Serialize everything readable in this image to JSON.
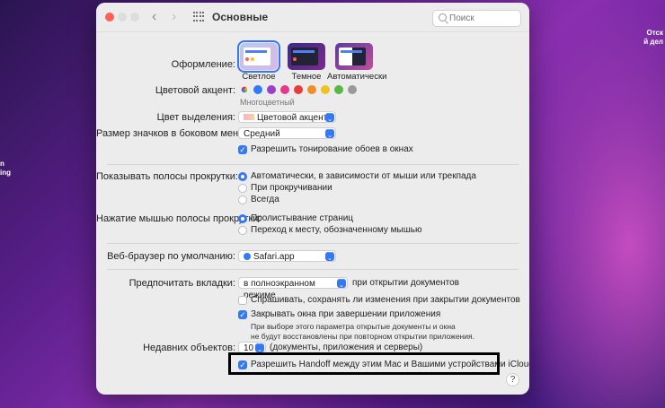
{
  "desktop": {
    "left_text_1": "n",
    "left_text_2": "ing",
    "right_text_1": "Отск",
    "right_text_2": "й дел"
  },
  "window": {
    "title": "Основные",
    "search_placeholder": "Поиск"
  },
  "appearance": {
    "label": "Оформление:",
    "options": [
      {
        "label": "Светлое",
        "selected": true
      },
      {
        "label": "Темное",
        "selected": false
      },
      {
        "label": "Автоматически",
        "selected": false
      }
    ]
  },
  "accent": {
    "label": "Цветовой акцент:",
    "caption": "Многоцветный",
    "colors": [
      "multicolor",
      "#2f7cf6",
      "#9a41c9",
      "#e6388b",
      "#ea3a3a",
      "#f18d26",
      "#f2c11c",
      "#5ab743",
      "#9a9a9a"
    ]
  },
  "highlight": {
    "label": "Цвет выделения:",
    "value": "Цветовой акцент"
  },
  "sidebar_icon": {
    "label": "Размер значков в боковом меню:",
    "value": "Средний"
  },
  "wallpaper_tint": {
    "label": "Разрешить тонирование обоев в окнах",
    "checked": true
  },
  "scrollbars": {
    "label": "Показывать полосы прокрутки:",
    "options": [
      "Автоматически, в зависимости от мыши или трекпада",
      "При прокручивании",
      "Всегда"
    ],
    "selected": 0
  },
  "scroll_click": {
    "label": "Нажатие мышью полосы прокрутки:",
    "options": [
      "Пролистывание страниц",
      "Переход к месту, обозначенному мышью"
    ],
    "selected": 0
  },
  "browser": {
    "label": "Веб-браузер по умолчанию:",
    "value": "Safari.app"
  },
  "tabs": {
    "label": "Предпочитать вкладки:",
    "value": "в полноэкранном режиме",
    "suffix": "при открытии документов"
  },
  "ask_save": {
    "label": "Спрашивать, сохранять ли изменения при закрытии документов",
    "checked": false
  },
  "close_windows": {
    "label": "Закрывать окна при завершении приложения",
    "checked": true
  },
  "close_note": {
    "line1": "При выборе этого параметра открытые документы и окна",
    "line2": "не будут восстановлены при повторном открытии приложения."
  },
  "recent": {
    "label": "Недавних объектов:",
    "value": "10",
    "suffix": "(документы, приложения и серверы)"
  },
  "handoff": {
    "label": "Разрешить Handoff между этим Mac и Вашими устройствами iCloud",
    "checked": true
  },
  "help_label": "?"
}
